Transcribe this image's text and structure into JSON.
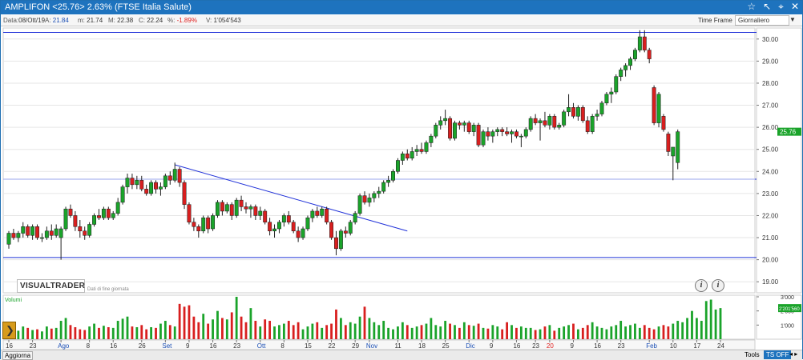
{
  "title_bar": {
    "text": "AMPLIFON <25.76> 2.63%  (FTSE Italia Salute)",
    "icons": [
      "star-icon",
      "draw-arrow-icon",
      "crosshair-icon",
      "close-icon"
    ]
  },
  "info_bar": {
    "data_label": "Data:",
    "date": "08/Ott/19",
    "a_label": "A:",
    "open": "21.84",
    "m_label": "m:",
    "low": "21.74",
    "m2_label": "M:",
    "high": "22.38",
    "c_label": "C:",
    "close": "22.24",
    "pct_label": "%:",
    "pct": "-1.89%",
    "v_label": "V:",
    "volume": "1'054'543",
    "time_frame_label": "Time Frame",
    "time_frame_value": "Giornaliero"
  },
  "logo": {
    "text": "VISUALTRADER",
    "subtitle": "Dati di fine giornata"
  },
  "volume_panel": {
    "label": "Volumi",
    "last_value": "2'201'560"
  },
  "bottom_bar": {
    "aggiorna": "Aggiorna",
    "tools": "Tools",
    "ts_off": "TS OFF"
  },
  "colors": {
    "up": "#1aa32a",
    "down": "#d81f1f",
    "lines": "#1f30d8",
    "accent": "#1e73be"
  },
  "chart_data": [
    {
      "type": "candlestick",
      "price_axis": {
        "ylim": [
          18.5,
          30.5
        ],
        "ticks": [
          "19.00",
          "20.00",
          "21.00",
          "22.00",
          "23.00",
          "24.00",
          "25.00",
          "26.00",
          "27.00",
          "28.00",
          "29.00",
          "30.00"
        ]
      },
      "last_price_label": "25.76",
      "x_ticks": [
        {
          "label": "16",
          "i": 0
        },
        {
          "label": "23",
          "i": 5
        },
        {
          "label": "Ago",
          "i": 11,
          "color": "#1b4fb5"
        },
        {
          "label": "8",
          "i": 17
        },
        {
          "label": "16",
          "i": 22
        },
        {
          "label": "26",
          "i": 28
        },
        {
          "label": "Set",
          "i": 33,
          "color": "#1b4fb5"
        },
        {
          "label": "9",
          "i": 38
        },
        {
          "label": "16",
          "i": 43
        },
        {
          "label": "23",
          "i": 48
        },
        {
          "label": "Ott",
          "i": 53,
          "color": "#1b4fb5"
        },
        {
          "label": "8",
          "i": 58
        },
        {
          "label": "15",
          "i": 63
        },
        {
          "label": "22",
          "i": 68
        },
        {
          "label": "29",
          "i": 73
        },
        {
          "label": "Nov",
          "i": 76,
          "color": "#1b4fb5"
        },
        {
          "label": "11",
          "i": 82
        },
        {
          "label": "18",
          "i": 87
        },
        {
          "label": "25",
          "i": 92
        },
        {
          "label": "Dic",
          "i": 97,
          "color": "#1b4fb5"
        },
        {
          "label": "9",
          "i": 102
        },
        {
          "label": "16",
          "i": 107
        },
        {
          "label": "23",
          "i": 111
        },
        {
          "label": "20",
          "i": 114,
          "color": "#e0201f"
        },
        {
          "label": "9",
          "i": 119
        },
        {
          "label": "16",
          "i": 124
        },
        {
          "label": "23",
          "i": 129
        },
        {
          "label": "Feb",
          "i": 135,
          "color": "#1b4fb5"
        },
        {
          "label": "10",
          "i": 140
        },
        {
          "label": "17",
          "i": 145
        },
        {
          "label": "24",
          "i": 150
        }
      ],
      "horizontal_lines": [
        30.3,
        23.65,
        20.1
      ],
      "trendline": {
        "from": {
          "i": 35,
          "price": 24.3
        },
        "to": {
          "i": 84,
          "price": 21.3
        }
      },
      "candles": [
        [
          20.7,
          21.3,
          20.5,
          21.2
        ],
        [
          21.2,
          21.4,
          20.9,
          21.0
        ],
        [
          21.0,
          21.3,
          20.8,
          21.2
        ],
        [
          21.2,
          21.7,
          21.0,
          21.5
        ],
        [
          21.5,
          21.6,
          21.0,
          21.1
        ],
        [
          21.1,
          21.6,
          20.9,
          21.5
        ],
        [
          21.5,
          21.6,
          20.9,
          21.0
        ],
        [
          21.0,
          21.2,
          20.8,
          21.0
        ],
        [
          21.0,
          21.5,
          20.9,
          21.3
        ],
        [
          21.3,
          21.6,
          20.9,
          21.1
        ],
        [
          21.1,
          21.6,
          21.0,
          21.4
        ],
        [
          21.0,
          21.5,
          20.0,
          21.4
        ],
        [
          21.4,
          22.4,
          21.3,
          22.3
        ],
        [
          22.3,
          22.5,
          21.9,
          22.0
        ],
        [
          22.0,
          22.2,
          21.3,
          21.5
        ],
        [
          21.5,
          21.8,
          21.0,
          21.3
        ],
        [
          21.3,
          21.5,
          20.9,
          21.1
        ],
        [
          21.1,
          21.7,
          21.0,
          21.6
        ],
        [
          21.6,
          22.1,
          21.5,
          22.0
        ],
        [
          22.0,
          22.3,
          21.8,
          21.9
        ],
        [
          21.9,
          22.4,
          21.8,
          22.3
        ],
        [
          22.3,
          22.4,
          21.8,
          21.9
        ],
        [
          21.9,
          22.2,
          21.8,
          22.1
        ],
        [
          22.1,
          22.8,
          22.0,
          22.6
        ],
        [
          22.6,
          23.4,
          22.5,
          23.3
        ],
        [
          23.3,
          23.9,
          23.0,
          23.7
        ],
        [
          23.7,
          23.9,
          23.2,
          23.4
        ],
        [
          23.4,
          23.8,
          23.2,
          23.6
        ],
        [
          23.6,
          23.8,
          23.1,
          23.2
        ],
        [
          23.2,
          23.4,
          22.9,
          23.0
        ],
        [
          23.0,
          23.6,
          22.9,
          23.5
        ],
        [
          23.5,
          23.6,
          23.0,
          23.2
        ],
        [
          23.2,
          23.5,
          22.9,
          23.3
        ],
        [
          23.3,
          23.9,
          23.2,
          23.8
        ],
        [
          23.8,
          24.0,
          23.4,
          23.6
        ],
        [
          23.6,
          24.4,
          23.5,
          24.1
        ],
        [
          24.1,
          24.2,
          23.3,
          23.5
        ],
        [
          23.5,
          23.6,
          22.3,
          22.5
        ],
        [
          22.5,
          22.6,
          21.6,
          21.7
        ],
        [
          21.7,
          21.9,
          21.3,
          21.5
        ],
        [
          21.5,
          21.6,
          21.0,
          21.3
        ],
        [
          21.3,
          22.0,
          21.2,
          21.9
        ],
        [
          21.9,
          22.0,
          21.2,
          21.4
        ],
        [
          21.4,
          22.1,
          21.3,
          22.0
        ],
        [
          22.0,
          22.7,
          21.9,
          22.6
        ],
        [
          22.6,
          22.7,
          22.0,
          22.2
        ],
        [
          22.2,
          22.6,
          22.1,
          22.5
        ],
        [
          22.5,
          22.6,
          21.8,
          22.0
        ],
        [
          22.0,
          22.8,
          21.9,
          22.7
        ],
        [
          22.7,
          22.9,
          22.2,
          22.4
        ],
        [
          22.4,
          22.6,
          22.1,
          22.3
        ],
        [
          22.3,
          22.5,
          21.9,
          22.4
        ],
        [
          22.4,
          22.5,
          21.8,
          22.0
        ],
        [
          22.0,
          22.4,
          21.8,
          22.2
        ],
        [
          22.2,
          22.3,
          21.6,
          21.7
        ],
        [
          21.7,
          21.9,
          21.1,
          21.3
        ],
        [
          21.3,
          21.6,
          21.0,
          21.4
        ],
        [
          21.4,
          21.8,
          21.2,
          21.7
        ],
        [
          21.7,
          22.1,
          21.5,
          22.0
        ],
        [
          22.0,
          22.2,
          21.6,
          21.7
        ],
        [
          21.7,
          21.8,
          21.2,
          21.3
        ],
        [
          21.3,
          21.5,
          20.8,
          21.0
        ],
        [
          21.0,
          21.5,
          20.9,
          21.4
        ],
        [
          21.4,
          22.0,
          21.3,
          21.9
        ],
        [
          21.9,
          22.3,
          21.7,
          22.2
        ],
        [
          22.2,
          22.4,
          21.9,
          22.0
        ],
        [
          22.0,
          22.4,
          21.9,
          22.3
        ],
        [
          22.3,
          22.4,
          21.6,
          21.7
        ],
        [
          21.7,
          21.8,
          20.9,
          21.0
        ],
        [
          21.0,
          21.3,
          20.2,
          20.5
        ],
        [
          20.5,
          21.4,
          20.4,
          21.3
        ],
        [
          21.3,
          21.5,
          21.0,
          21.2
        ],
        [
          21.2,
          21.8,
          21.1,
          21.7
        ],
        [
          21.7,
          22.2,
          21.6,
          22.1
        ],
        [
          22.1,
          23.0,
          22.0,
          22.9
        ],
        [
          22.9,
          23.1,
          22.5,
          22.6
        ],
        [
          22.6,
          23.0,
          22.4,
          22.8
        ],
        [
          22.8,
          23.1,
          22.6,
          23.0
        ],
        [
          23.0,
          23.3,
          22.8,
          23.1
        ],
        [
          23.1,
          23.6,
          23.0,
          23.5
        ],
        [
          23.5,
          23.8,
          23.3,
          23.6
        ],
        [
          23.6,
          24.1,
          23.5,
          24.0
        ],
        [
          24.0,
          24.6,
          23.9,
          24.5
        ],
        [
          24.5,
          24.9,
          24.3,
          24.8
        ],
        [
          24.8,
          25.0,
          24.5,
          24.6
        ],
        [
          24.6,
          25.1,
          24.5,
          24.9
        ],
        [
          24.9,
          25.2,
          24.7,
          25.0
        ],
        [
          25.0,
          25.3,
          24.8,
          24.9
        ],
        [
          24.9,
          25.4,
          24.8,
          25.3
        ],
        [
          25.3,
          25.7,
          25.1,
          25.6
        ],
        [
          25.6,
          26.2,
          25.5,
          26.1
        ],
        [
          26.1,
          26.5,
          25.9,
          26.3
        ],
        [
          26.3,
          26.8,
          26.1,
          26.4
        ],
        [
          26.4,
          26.5,
          25.4,
          25.5
        ],
        [
          25.5,
          26.3,
          25.4,
          26.2
        ],
        [
          26.2,
          26.3,
          25.9,
          26.1
        ],
        [
          26.1,
          26.3,
          25.8,
          26.2
        ],
        [
          26.2,
          26.3,
          25.7,
          25.8
        ],
        [
          25.8,
          26.2,
          25.6,
          26.1
        ],
        [
          26.1,
          26.2,
          25.1,
          25.2
        ],
        [
          25.2,
          25.9,
          25.1,
          25.8
        ],
        [
          25.8,
          26.0,
          25.4,
          25.6
        ],
        [
          25.6,
          25.9,
          25.3,
          25.8
        ],
        [
          25.8,
          26.0,
          25.6,
          25.9
        ],
        [
          25.9,
          26.0,
          25.6,
          25.8
        ],
        [
          25.8,
          26.0,
          25.6,
          25.7
        ],
        [
          25.7,
          25.9,
          25.3,
          25.8
        ],
        [
          25.8,
          25.9,
          25.5,
          25.6
        ],
        [
          25.6,
          25.7,
          25.1,
          25.6
        ],
        [
          25.6,
          26.0,
          25.5,
          25.9
        ],
        [
          25.9,
          26.5,
          25.8,
          26.4
        ],
        [
          26.4,
          26.6,
          26.1,
          26.2
        ],
        [
          26.2,
          26.4,
          25.4,
          26.3
        ],
        [
          26.3,
          26.7,
          26.0,
          26.1
        ],
        [
          26.1,
          26.6,
          25.9,
          26.5
        ],
        [
          26.5,
          26.6,
          25.9,
          26.0
        ],
        [
          26.0,
          26.2,
          25.9,
          26.1
        ],
        [
          26.1,
          26.8,
          26.0,
          26.7
        ],
        [
          26.7,
          27.5,
          26.5,
          26.9
        ],
        [
          26.9,
          27.1,
          26.4,
          26.5
        ],
        [
          26.5,
          27.0,
          26.3,
          26.9
        ],
        [
          26.9,
          27.0,
          26.2,
          26.3
        ],
        [
          26.3,
          26.5,
          25.7,
          25.8
        ],
        [
          25.8,
          26.6,
          25.7,
          26.5
        ],
        [
          26.5,
          26.8,
          26.3,
          26.6
        ],
        [
          26.6,
          27.2,
          26.5,
          27.1
        ],
        [
          27.1,
          27.6,
          27.0,
          27.5
        ],
        [
          27.5,
          27.8,
          27.1,
          27.6
        ],
        [
          27.6,
          28.4,
          27.5,
          28.3
        ],
        [
          28.3,
          28.7,
          28.1,
          28.6
        ],
        [
          28.6,
          28.9,
          28.3,
          28.8
        ],
        [
          28.8,
          29.2,
          28.6,
          29.1
        ],
        [
          29.1,
          29.6,
          29.0,
          29.5
        ],
        [
          29.5,
          30.4,
          29.4,
          30.1
        ],
        [
          30.1,
          30.4,
          29.4,
          29.5
        ],
        [
          29.5,
          29.6,
          28.9,
          29.1
        ],
        [
          27.8,
          27.9,
          26.1,
          26.2
        ],
        [
          26.2,
          27.6,
          26.0,
          27.5
        ],
        [
          26.5,
          26.6,
          25.8,
          25.9
        ],
        [
          25.7,
          25.8,
          24.7,
          24.9
        ],
        [
          24.7,
          25.1,
          23.6,
          25.1
        ],
        [
          24.4,
          25.9,
          24.1,
          25.8
        ]
      ]
    },
    {
      "type": "bar",
      "name": "Volumi",
      "ylim": [
        0,
        3000000
      ],
      "ticks": [
        "1'000",
        "2'000",
        "3'000"
      ],
      "values": [
        500,
        700,
        600,
        900,
        800,
        650,
        700,
        550,
        900,
        750,
        800,
        1300,
        1500,
        1000,
        850,
        700,
        650,
        900,
        1100,
        800,
        950,
        850,
        800,
        1300,
        1450,
        1600,
        900,
        850,
        1000,
        700,
        850,
        800,
        1100,
        1300,
        1000,
        900,
        2500,
        2300,
        2400,
        1600,
        1200,
        1800,
        1100,
        1400,
        2000,
        1500,
        1400,
        1900,
        3000,
        1600,
        1200,
        2200,
        1300,
        900,
        1400,
        1300,
        900,
        1000,
        1100,
        1300,
        1000,
        1200,
        700,
        900,
        1100,
        1200,
        800,
        1000,
        1100,
        2100,
        1500,
        1000,
        1200,
        1100,
        1600,
        2300,
        1500,
        1200,
        1000,
        1300,
        800,
        700,
        900,
        1200,
        1000,
        800,
        900,
        1000,
        1100,
        1500,
        1000,
        900,
        1300,
        1100,
        1000,
        800,
        1200,
        1000,
        950,
        1100,
        800,
        750,
        1000,
        900,
        700,
        1200,
        1000,
        800,
        900,
        800,
        800,
        650,
        700,
        900,
        1000,
        600,
        800,
        900,
        1000,
        1100,
        700,
        800,
        1000,
        1200,
        900,
        800,
        700,
        900,
        1000,
        1300,
        900,
        1000,
        1100,
        800,
        1000,
        800,
        700,
        900,
        1000,
        900,
        1100,
        1300,
        1200,
        1500,
        2000,
        1500,
        1300,
        2700,
        2800,
        2100,
        2201
      ]
    }
  ]
}
